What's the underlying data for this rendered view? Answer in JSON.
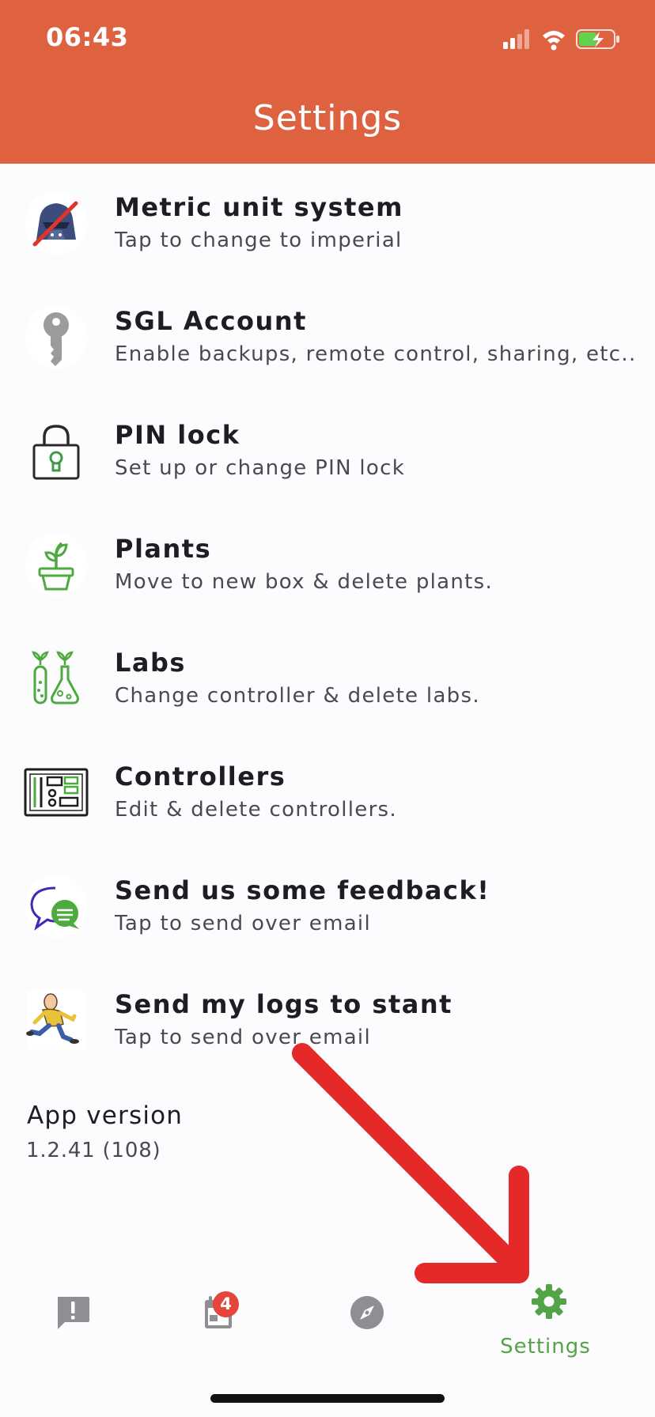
{
  "status_bar": {
    "time": "06:43",
    "icons": [
      "cellular-signal-icon",
      "wifi-icon",
      "battery-charging-icon"
    ]
  },
  "header": {
    "title": "Settings"
  },
  "settings": [
    {
      "name": "metric-unit-system",
      "title": "Metric unit system",
      "subtitle": "Tap to change to imperial",
      "icon": "darth-vader-helmet-crossed-icon"
    },
    {
      "name": "sgl-account",
      "title": "SGL Account",
      "subtitle": "Enable backups, remote control, sharing, etc..",
      "icon": "key-icon"
    },
    {
      "name": "pin-lock",
      "title": "PIN lock",
      "subtitle": "Set up or change PIN lock",
      "icon": "padlock-icon"
    },
    {
      "name": "plants",
      "title": "Plants",
      "subtitle": "Move to new box & delete plants.",
      "icon": "potted-plant-icon"
    },
    {
      "name": "labs",
      "title": "Labs",
      "subtitle": "Change controller & delete labs.",
      "icon": "test-tube-flask-icon"
    },
    {
      "name": "controllers",
      "title": "Controllers",
      "subtitle": "Edit & delete controllers.",
      "icon": "circuit-board-icon"
    },
    {
      "name": "send-feedback",
      "title": "Send us some feedback!",
      "subtitle": "Tap to send over email",
      "icon": "chat-bubbles-icon"
    },
    {
      "name": "send-logs",
      "title": "Send my logs to stant",
      "subtitle": "Tap to send over email",
      "icon": "running-man-icon"
    }
  ],
  "app_version": {
    "label": "App version",
    "value": "1.2.41 (108)"
  },
  "tabbar": {
    "tabs": [
      {
        "name": "tab-alerts",
        "icon": "alert-message-icon",
        "label": "",
        "active": false
      },
      {
        "name": "tab-calendar",
        "icon": "calendar-icon",
        "label": "",
        "active": false,
        "badge": "4"
      },
      {
        "name": "tab-explore",
        "icon": "compass-icon",
        "label": "",
        "active": false
      },
      {
        "name": "tab-settings",
        "icon": "gear-icon",
        "label": "Settings",
        "active": true
      }
    ]
  },
  "colors": {
    "header_bg": "#DF6240",
    "page_bg": "#FCFBFD",
    "accent_green": "#52A447",
    "inactive_icon": "#8E8E93",
    "badge_red": "#E5453B",
    "annotation_arrow": "#E52828"
  }
}
